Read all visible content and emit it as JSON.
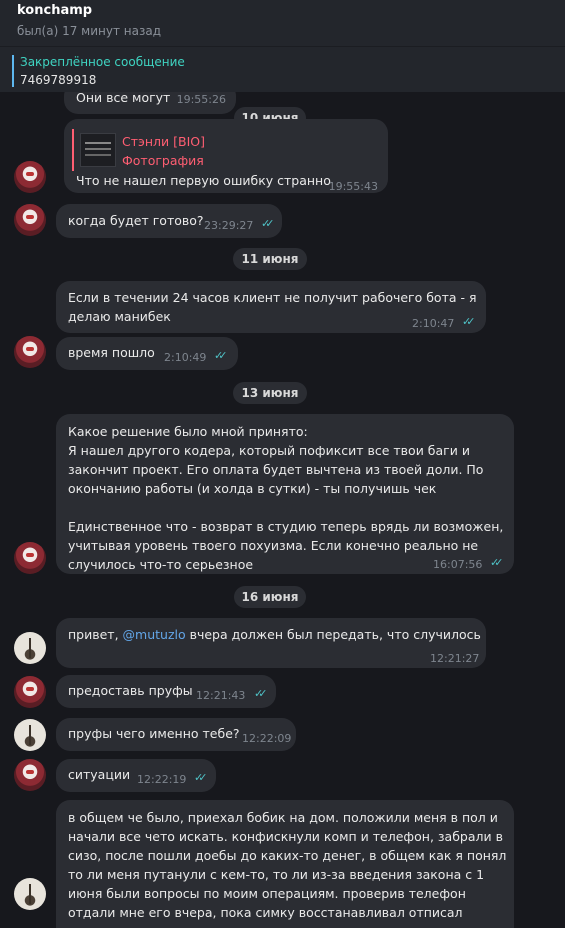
{
  "header": {
    "title": "konchamp",
    "status": "был(а) 17 минут назад"
  },
  "pinned": {
    "title": "Закреплённое сообщение",
    "text": "7469789918"
  },
  "dates": {
    "d1": "10 июня",
    "d2": "11 июня",
    "d3": "13 июня",
    "d4": "16 июня"
  },
  "messages": {
    "m0": {
      "text": "Они все могут",
      "time": "19:55:26"
    },
    "m1": {
      "reply_name": "Стэнли [BIO]",
      "reply_sub": "Фотография",
      "text": "Что не нашел первую ошибку странно",
      "time": "19:55:43"
    },
    "m2": {
      "text": "когда будет готово?",
      "time": "23:29:27",
      "status": "read"
    },
    "m3": {
      "line1": "Если в течении 24 часов клиент не получит рабочего бота - я",
      "line2": "делаю манибек",
      "time": "2:10:47",
      "status": "read"
    },
    "m4": {
      "text": "время пошло",
      "time": "2:10:49",
      "status": "read"
    },
    "m5": {
      "line1": "Какое решение было мной принято:",
      "line2": "Я нашел другого кодера, который пофиксит все твои баги и",
      "line3": "закончит проект. Его оплата будет вычтена из твоей доли. По",
      "line4": "окончанию работы (и холда в сутки) - ты получишь чек",
      "line5": "Единственное что - возврат в студию теперь врядь ли возможен,",
      "line6": "учитывая уровень твоего похуизма. Если конечно реально не",
      "line7": "случилось что-то серьезное",
      "time": "16:07:56",
      "status": "read"
    },
    "m6": {
      "text_before": "привет, ",
      "mention": "@mutuzlo",
      "text_after": " вчера должен был передать, что случилось",
      "time": "12:21:27"
    },
    "m7": {
      "text": "предоставь пруфы",
      "time": "12:21:43",
      "status": "read"
    },
    "m8": {
      "text": "пруфы чего именно тебе?",
      "time": "12:22:09"
    },
    "m9": {
      "text": "ситуации",
      "time": "12:22:19",
      "status": "read"
    },
    "m10": {
      "line1": "в общем че было, приехал бобик на дом. положили меня в пол и",
      "line2": "начали все чето искать. конфискнули комп и телефон, забрали в",
      "line3": "сизо, после пошли доебы до каких-то денег, в общем как я понял",
      "line4": "то ли меня путанули с кем-то, то ли из-за введения закона с 1",
      "line5": "июня были вопросы по моим операциям. проверив телефон",
      "line6": "отдали мне его вчера, пока симку восстанавливал отписал"
    }
  },
  "colors": {
    "accent_teal": "#3fd4c2",
    "check": "#4fc3c7",
    "reply_pink": "#ff5e72",
    "mention_blue": "#63a6e8"
  }
}
